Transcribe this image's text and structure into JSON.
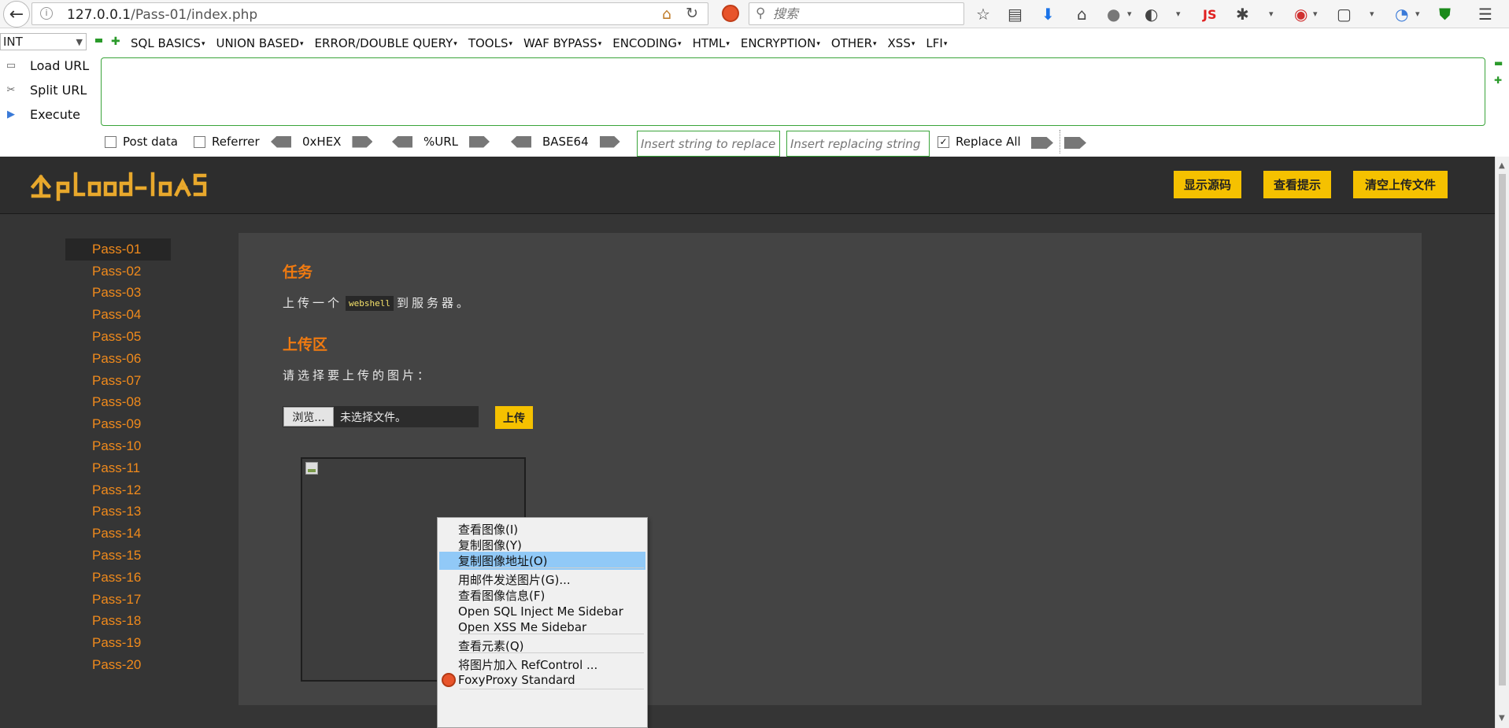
{
  "browser": {
    "url_host": "127.0.0.1",
    "url_path": "/Pass-01/index.php",
    "search_placeholder": "搜索",
    "js_badge": "JS"
  },
  "hackbar": {
    "select_value": "INT",
    "menus": [
      "SQL BASICS",
      "UNION BASED",
      "ERROR/DOUBLE QUERY",
      "TOOLS",
      "WAF BYPASS",
      "ENCODING",
      "HTML",
      "ENCRYPTION",
      "OTHER",
      "XSS",
      "LFI"
    ],
    "load_url": "Load URL",
    "split_url": "Split URL",
    "execute": "Execute",
    "post_data": "Post data",
    "referrer": "Referrer",
    "hex": "0xHEX",
    "url_enc": "%URL",
    "base64": "BASE64",
    "replace_placeholder": "Insert string to replace",
    "replacing_placeholder": "Insert replacing string",
    "replace_all": "Replace All",
    "replace_all_checked": true
  },
  "site": {
    "header_buttons": [
      "显示源码",
      "查看提示",
      "清空上传文件"
    ],
    "nav": [
      "Pass-01",
      "Pass-02",
      "Pass-03",
      "Pass-04",
      "Pass-05",
      "Pass-06",
      "Pass-07",
      "Pass-08",
      "Pass-09",
      "Pass-10",
      "Pass-11",
      "Pass-12",
      "Pass-13",
      "Pass-14",
      "Pass-15",
      "Pass-16",
      "Pass-17",
      "Pass-18",
      "Pass-19",
      "Pass-20"
    ],
    "active_nav": "Pass-01",
    "task_title": "任务",
    "task_pre": "上传一个",
    "task_code": "webshell",
    "task_post": "到服务器。",
    "upload_title": "上传区",
    "upload_prompt": "请选择要上传的图片：",
    "browse_label": "浏览...",
    "file_status": "未选择文件。",
    "upload_button": "上传"
  },
  "context_menu": {
    "items": [
      {
        "label": "查看图像(I)",
        "highlighted": false
      },
      {
        "label": "复制图像(Y)",
        "highlighted": false
      },
      {
        "label": "复制图像地址(O)",
        "highlighted": true
      },
      {
        "label": "用邮件发送图片(G)...",
        "highlighted": false
      },
      {
        "label": "查看图像信息(F)",
        "highlighted": false
      },
      {
        "label": "Open SQL Inject Me Sidebar",
        "highlighted": false
      },
      {
        "label": "Open XSS Me Sidebar",
        "highlighted": false
      },
      {
        "label": "查看元素(Q)",
        "highlighted": false
      },
      {
        "label": "将图片加入 RefControl ...",
        "highlighted": false
      },
      {
        "label": "FoxyProxy Standard",
        "highlighted": false
      }
    ]
  },
  "colors": {
    "accent_orange": "#f08a1c",
    "button_yellow": "#f5c100",
    "page_bg": "#353535",
    "highlight_blue": "#91c9f7"
  }
}
